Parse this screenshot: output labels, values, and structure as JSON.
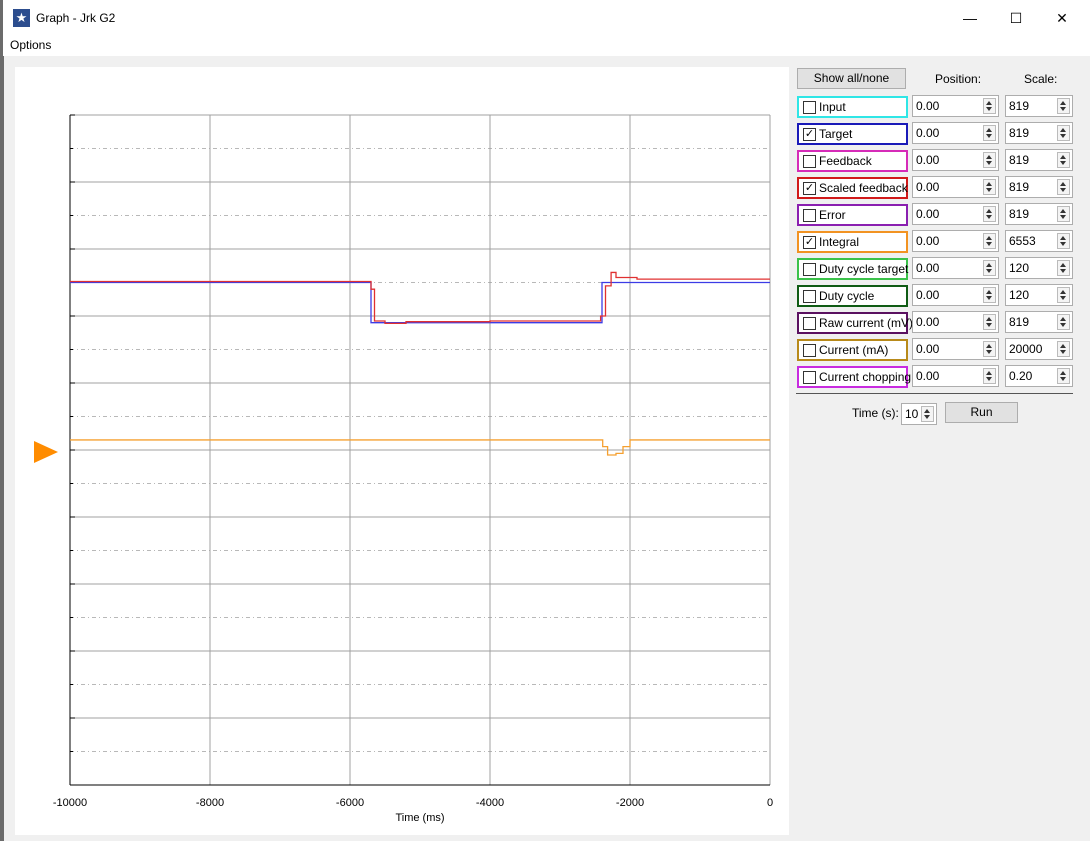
{
  "window": {
    "title": "Graph - Jrk G2"
  },
  "menu": {
    "options": "Options"
  },
  "controls_header": {
    "show_all": "Show all/none",
    "position": "Position:",
    "scale": "Scale:"
  },
  "rows": [
    {
      "label": "Input",
      "checked": false,
      "color": "#2fe6e6",
      "position": "0.00",
      "scale": "819"
    },
    {
      "label": "Target",
      "checked": true,
      "color": "#1a1ab8",
      "position": "0.00",
      "scale": "819"
    },
    {
      "label": "Feedback",
      "checked": false,
      "color": "#d62bb8",
      "position": "0.00",
      "scale": "819"
    },
    {
      "label": "Scaled feedback",
      "checked": true,
      "color": "#d11a1a",
      "position": "0.00",
      "scale": "819"
    },
    {
      "label": "Error",
      "checked": false,
      "color": "#8a1fb0",
      "position": "0.00",
      "scale": "819"
    },
    {
      "label": "Integral",
      "checked": true,
      "color": "#f29322",
      "position": "0.00",
      "scale": "6553"
    },
    {
      "label": "Duty cycle target",
      "checked": false,
      "color": "#3bc24a",
      "position": "0.00",
      "scale": "120"
    },
    {
      "label": "Duty cycle",
      "checked": false,
      "color": "#0f5b14",
      "position": "0.00",
      "scale": "120"
    },
    {
      "label": "Raw current (mV)",
      "checked": false,
      "color": "#5a1160",
      "position": "0.00",
      "scale": "819"
    },
    {
      "label": "Current (mA)",
      "checked": false,
      "color": "#b88a1a",
      "position": "0.00",
      "scale": "20000"
    },
    {
      "label": "Current chopping",
      "checked": false,
      "color": "#c82be0",
      "position": "0.00",
      "scale": "0.20"
    }
  ],
  "time": {
    "label": "Time (s):",
    "value": "10",
    "run": "Run"
  },
  "chart_data": {
    "type": "line",
    "xlabel": "Time (ms)",
    "xlim": [
      -10000,
      0
    ],
    "x_ticks": [
      "-10000",
      "-8000",
      "-6000",
      "-4000",
      "-2000",
      "0"
    ],
    "grid": true,
    "series": [
      {
        "name": "Target",
        "color": "#3c3ce6",
        "x": [
          -10000,
          -5700,
          -5700,
          -2400,
          -2400,
          0
        ],
        "y": [
          0.5,
          0.5,
          0.38,
          0.38,
          0.5,
          0.5
        ]
      },
      {
        "name": "Scaled feedback",
        "color": "#e03030",
        "x": [
          -10000,
          -5720,
          -5700,
          -5650,
          -5500,
          -5200,
          -4000,
          -2450,
          -2420,
          -2350,
          -2320,
          -2270,
          -2200,
          -1900,
          0
        ],
        "y": [
          0.503,
          0.503,
          0.48,
          0.385,
          0.378,
          0.383,
          0.385,
          0.385,
          0.4,
          0.49,
          0.49,
          0.53,
          0.515,
          0.51,
          0.51
        ]
      },
      {
        "name": "Integral",
        "color": "#f5a030",
        "x": [
          -10000,
          -2400,
          -2390,
          -2350,
          -2320,
          -2200,
          -2100,
          -2000,
          0
        ],
        "y": [
          0.03,
          0.03,
          0.01,
          0.01,
          -0.015,
          -0.01,
          0.01,
          0.03,
          0.03
        ]
      }
    ],
    "y_view": [
      -1,
      1
    ]
  }
}
